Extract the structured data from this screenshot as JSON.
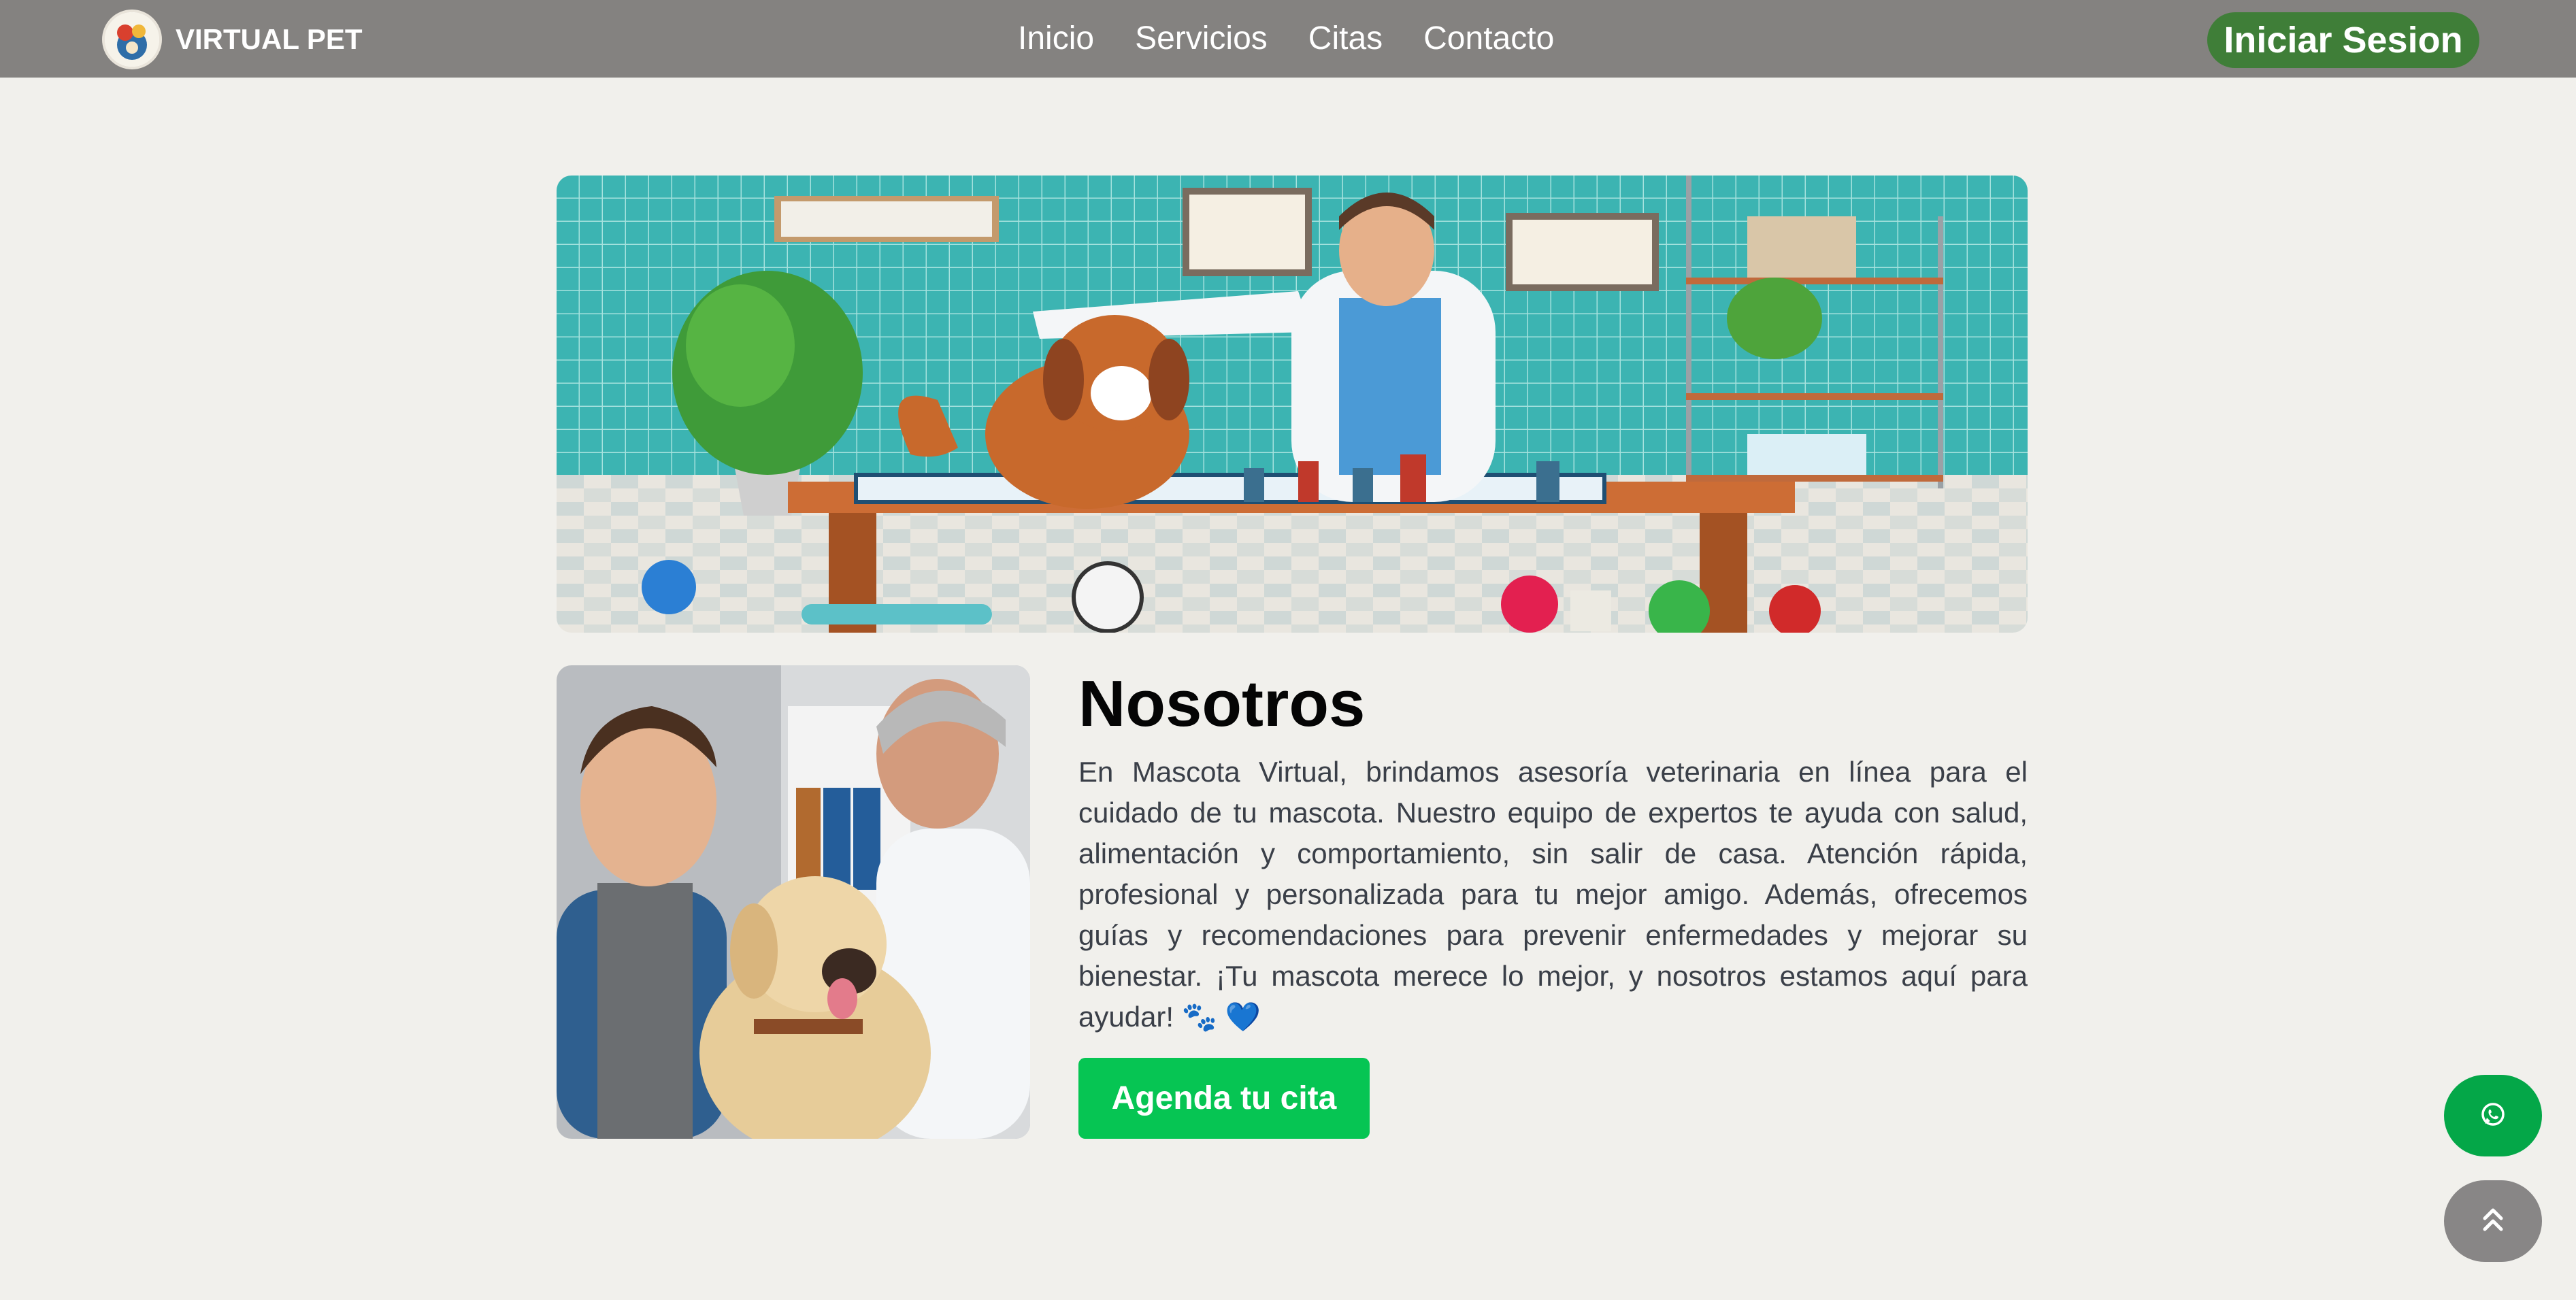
{
  "header": {
    "brand": "VIRTUAL PET",
    "nav": [
      "Inicio",
      "Servicios",
      "Citas",
      "Contacto"
    ],
    "login_label": "Iniciar Sesion"
  },
  "about": {
    "title": "Nosotros",
    "text": "En Mascota Virtual, brindamos asesoría veterinaria en línea para el cuidado de tu mascota. Nuestro equipo de expertos te ayuda con salud, alimentación y comportamiento, sin salir de casa. Atención rápida, profesional y personalizada para tu mejor amigo. Además, ofrecemos guías y recomendaciones para prevenir enfermedades y mejorar su bienestar. ¡Tu mascota merece lo mejor, y nosotros estamos aquí para ayudar! 🐾 💙",
    "cta_label": "Agenda tu cita"
  },
  "icons": {
    "whatsapp": "whatsapp-icon",
    "scroll_top": "double-chevron-up-icon"
  },
  "colors": {
    "navbar": "#848280",
    "login": "#3f7e38",
    "cta": "#06c553",
    "whatsapp": "#04a748"
  }
}
